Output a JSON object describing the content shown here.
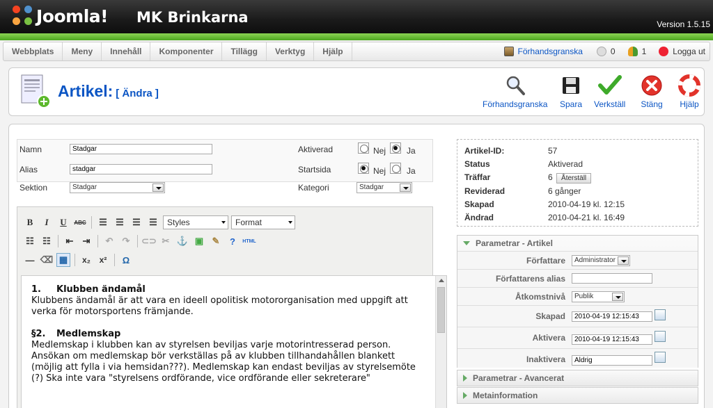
{
  "header": {
    "logo_text": "Joomla!",
    "site_name": "MK Brinkarna",
    "version": "Version 1.5.15"
  },
  "menu": {
    "items": [
      "Webbplats",
      "Meny",
      "Innehåll",
      "Komponenter",
      "Tillägg",
      "Verktyg",
      "Hjälp"
    ],
    "preview": "Förhandsgranska",
    "messages_count": "0",
    "users_count": "1",
    "logout": "Logga ut"
  },
  "toolbar": {
    "title": "Artikel:",
    "subtitle": "[ Ändra ]",
    "buttons": {
      "preview": "Förhandsgranska",
      "save": "Spara",
      "apply": "Verkställ",
      "close": "Stäng",
      "help": "Hjälp"
    }
  },
  "form": {
    "name_label": "Namn",
    "name_value": "Stadgar",
    "alias_label": "Alias",
    "alias_value": "stadgar",
    "section_label": "Sektion",
    "section_value": "Stadgar",
    "published_label": "Aktiverad",
    "frontpage_label": "Startsida",
    "category_label": "Kategori",
    "category_value": "Stadgar",
    "no": "Nej",
    "yes": "Ja"
  },
  "editor": {
    "styles": "Styles",
    "format": "Format",
    "html_label": "HTML",
    "content": {
      "h1_num": "1.",
      "h1": "Klubben ändamål",
      "p1": "Klubbens ändamål är att vara en ideell opolitisk motororganisation med uppgift att verka för motorsportens främjande.",
      "h2_num": "§2.",
      "h2": "Medlemskap",
      "p2": "Medlemskap i klubben kan av styrelsen beviljas varje motorintresserad person. Ansökan om medlemskap bör verkställas på av klubben tillhandahållen blankett (möjlig att fylla i via hemsidan???). Medlemskap kan endast beviljas av styrelsemöte (?) Ska inte vara \"styrelsens ordförande, vice ordförande eller sekreterare\""
    }
  },
  "info": {
    "id_label": "Artikel-ID:",
    "id_value": "57",
    "status_label": "Status",
    "status_value": "Aktiverad",
    "hits_label": "Träffar",
    "hits_value": "6",
    "reset": "Återställ",
    "revised_label": "Reviderad",
    "revised_value": "6 gånger",
    "created_label": "Skapad",
    "created_value": "2010-04-19 kl. 12:15",
    "modified_label": "Ändrad",
    "modified_value": "2010-04-21 kl. 16:49"
  },
  "params": {
    "article_header": "Parametrar - Artikel",
    "author_label": "Författare",
    "author_value": "Administrator",
    "author_alias_label": "Författarens alias",
    "author_alias_value": "",
    "access_label": "Åtkomstnivå",
    "access_value": "Publik",
    "created_label": "Skapad",
    "created_value": "2010-04-19 12:15:43",
    "publish_up_label": "Aktivera",
    "publish_up_value": "2010-04-19 12:15:43",
    "publish_down_label": "Inaktivera",
    "publish_down_value": "Aldrig",
    "advanced_header": "Parametrar - Avancerat",
    "meta_header": "Metainformation"
  },
  "colors": {
    "link_blue": "#0b55c4",
    "green_bar": "#5cb82c",
    "header_dark": "#1a1a1a"
  }
}
